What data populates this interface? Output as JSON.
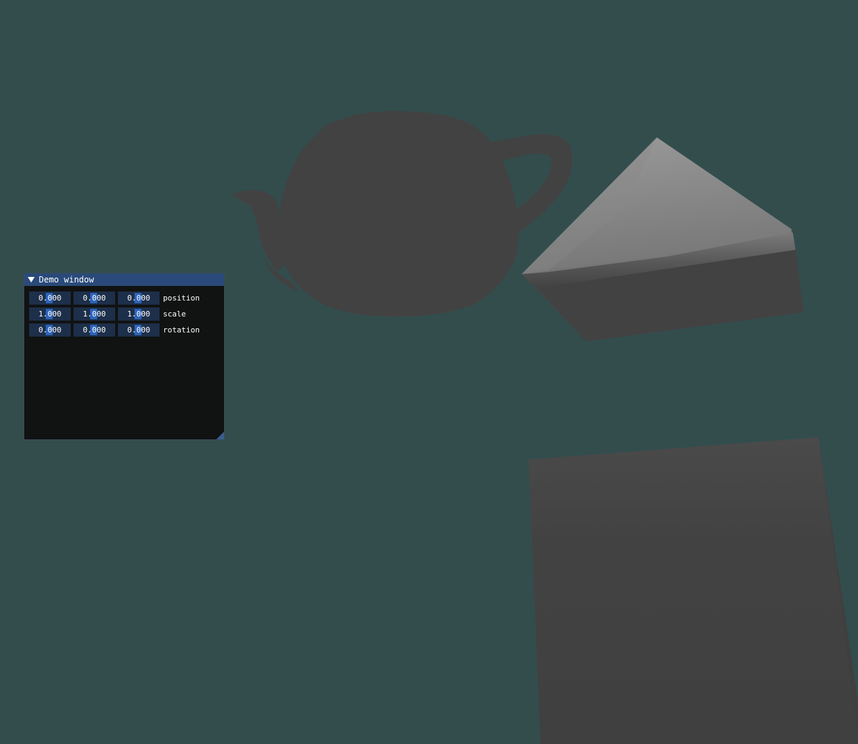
{
  "colors": {
    "background": "#334d4d",
    "object": "#424242",
    "window_bg": "#0f0f0f",
    "title_bg": "#294a7a",
    "field_bg": "#1d2f4a",
    "selection": "#2f6fd1"
  },
  "scene": {
    "objects": [
      "teapot",
      "pyramid",
      "cube"
    ]
  },
  "window": {
    "title": "Demo window",
    "collapse_icon": "triangle-down-icon",
    "rows": [
      {
        "label": "position",
        "values": [
          "0.000",
          "0.000",
          "0.000"
        ]
      },
      {
        "label": "scale",
        "values": [
          "1.000",
          "1.000",
          "1.000"
        ]
      },
      {
        "label": "rotation",
        "values": [
          "0.000",
          "0.000",
          "0.000"
        ]
      }
    ]
  }
}
